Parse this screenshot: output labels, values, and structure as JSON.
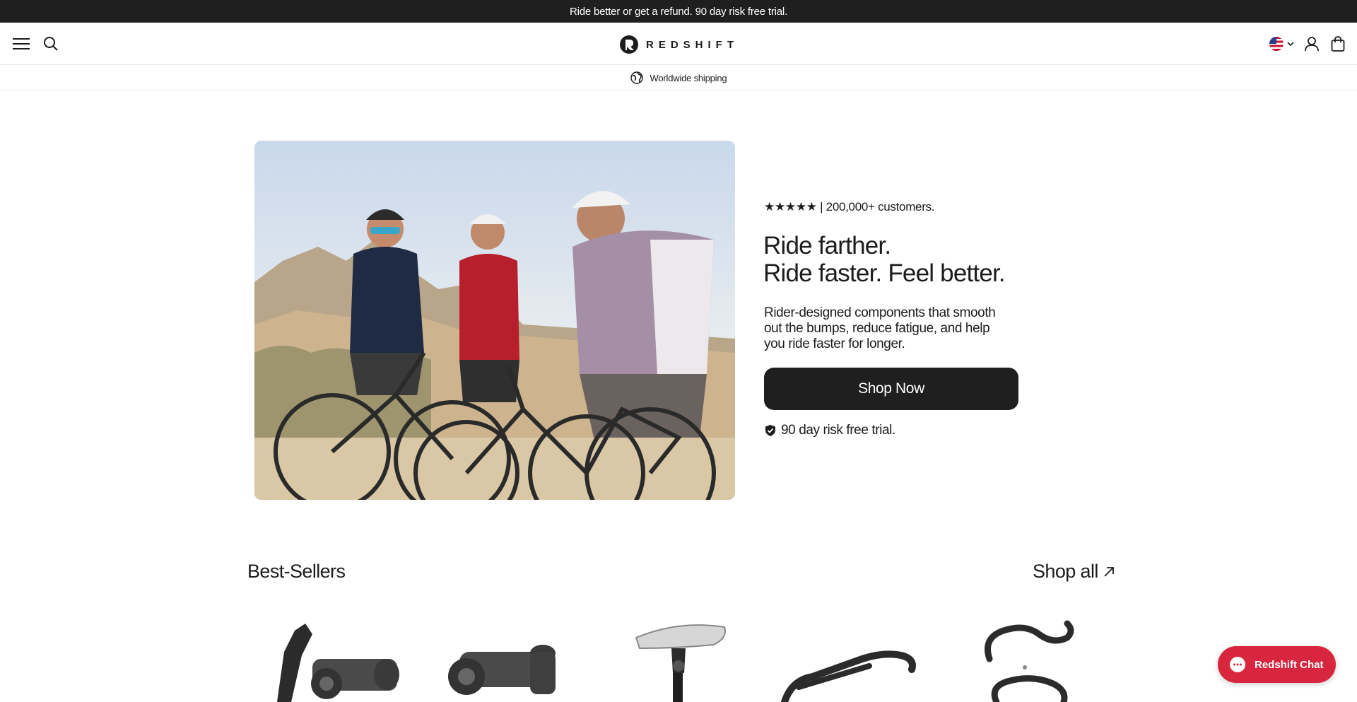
{
  "announcement": {
    "text": "Ride better or get a refund. 90 day risk free trial."
  },
  "header": {
    "brand": "REDSHIFT"
  },
  "shipping": {
    "text": "Worldwide shipping"
  },
  "hero": {
    "rating_text": "★★★★★ | 200,000+ customers.",
    "title_line1": "Ride farther.",
    "title_line2": "Ride faster. Feel better.",
    "description": "Rider-designed components that smooth out the bumps, reduce fatigue, and help you ride faster for longer.",
    "cta_label": "Shop Now",
    "trial_text": "90 day risk free trial."
  },
  "best_sellers": {
    "title": "Best-Sellers",
    "shop_all_label": "Shop all"
  },
  "chat": {
    "label": "Redshift Chat"
  },
  "colors": {
    "dark": "#1f1f1f",
    "chat": "#d7263d",
    "text": "#1c1c1c"
  }
}
